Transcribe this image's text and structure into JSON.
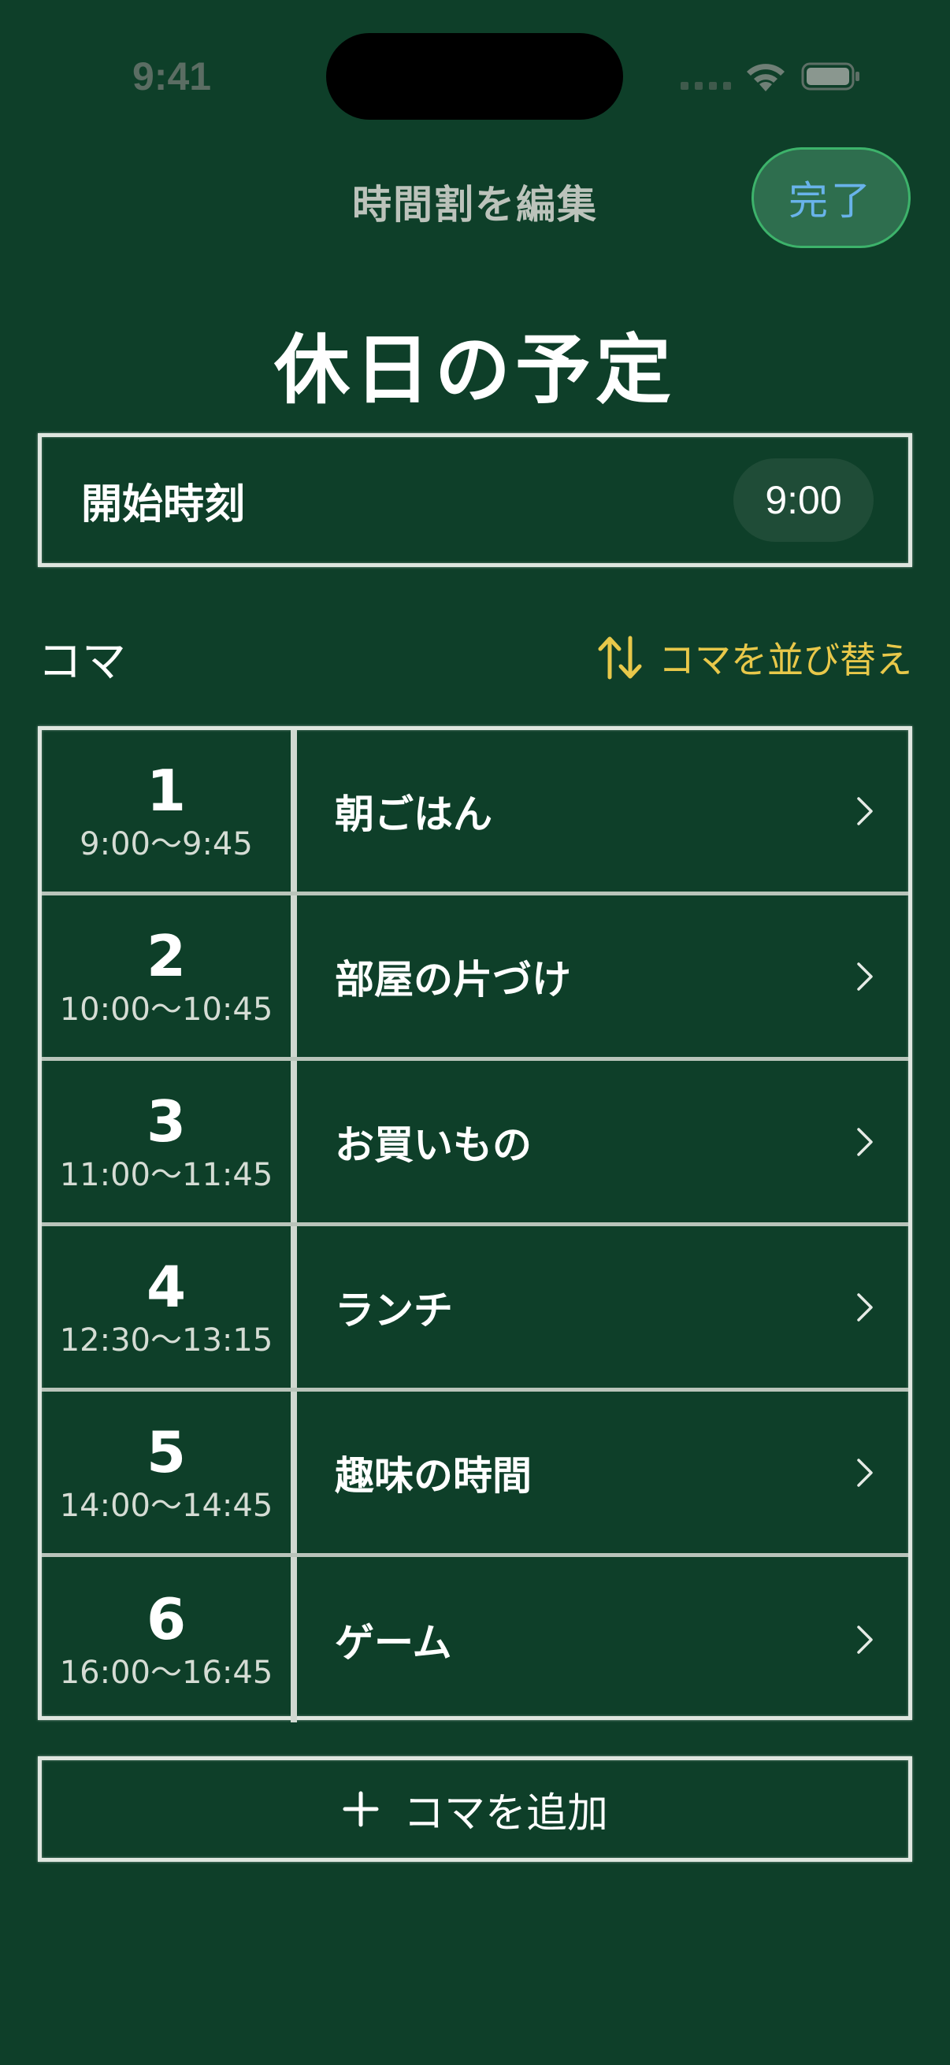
{
  "status_bar": {
    "time": "9:41"
  },
  "nav": {
    "title": "時間割を編集",
    "done_label": "完了"
  },
  "page_title": "休日の予定",
  "start_time": {
    "label": "開始時刻",
    "value": "9:00"
  },
  "section": {
    "title": "コマ",
    "reorder_label": "コマを並び替え"
  },
  "periods": [
    {
      "number": "1",
      "time": "9:00〜9:45",
      "name": "朝ごはん"
    },
    {
      "number": "2",
      "time": "10:00〜10:45",
      "name": "部屋の片づけ"
    },
    {
      "number": "3",
      "time": "11:00〜11:45",
      "name": "お買いもの"
    },
    {
      "number": "4",
      "time": "12:30〜13:15",
      "name": "ランチ"
    },
    {
      "number": "5",
      "time": "14:00〜14:45",
      "name": "趣味の時間"
    },
    {
      "number": "6",
      "time": "16:00〜16:45",
      "name": "ゲーム"
    }
  ],
  "add_label": "コマを追加",
  "colors": {
    "background": "#0e3f29",
    "accent_yellow": "#e8c84a",
    "done_text": "#69b3ea",
    "done_border": "#3db36b"
  },
  "icons": [
    "wifi-icon",
    "battery-icon",
    "reorder-arrows-icon",
    "chevron-right-icon",
    "plus-icon"
  ]
}
